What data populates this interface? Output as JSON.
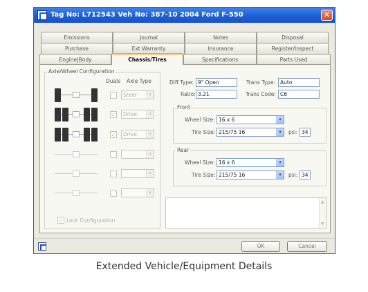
{
  "window": {
    "title": "Tag No: L712543 Veh No: 387-10 2004 Ford F-550",
    "close_glyph": "✕"
  },
  "tabs": {
    "row1": [
      "Emissions",
      "Journal",
      "Notes",
      "Disposal"
    ],
    "row2": [
      "Purchase",
      "Ext Warranty",
      "Insurance",
      "Register/Inspect"
    ],
    "row3": [
      "Engine|Body",
      "Chassis/Tires",
      "Specifications",
      "Parts Used"
    ],
    "active": "Chassis/Tires"
  },
  "axle_config": {
    "legend": "Axle/Wheel Configuration",
    "duals_header": "Duals",
    "axle_type_header": "Axle Type",
    "rows": [
      {
        "duals": false,
        "type": "Steer",
        "tires": 2
      },
      {
        "duals": true,
        "type": "Drive",
        "tires": 4
      },
      {
        "duals": true,
        "type": "Drive",
        "tires": 4
      },
      {
        "duals": false,
        "type": "",
        "tires": 0
      },
      {
        "duals": false,
        "type": "",
        "tires": 0
      },
      {
        "duals": false,
        "type": "",
        "tires": 0
      }
    ],
    "lock_label": "Lock Configuration",
    "lock_checked": true
  },
  "diff": {
    "diff_type_label": "Diff Type:",
    "diff_type": "9\" Open",
    "ratio_label": "Ratio:",
    "ratio": "3.21",
    "trans_type_label": "Trans Type:",
    "trans_type": "Auto",
    "trans_code_label": "Trans Code:",
    "trans_code": "C6"
  },
  "front": {
    "legend": "Front",
    "wheel_size_label": "Wheel Size:",
    "wheel_size": "16 x 6",
    "tire_size_label": "Tire Size:",
    "tire_size": "215/75 16",
    "psi_label": "psi:",
    "psi": "34"
  },
  "rear": {
    "legend": "Rear",
    "wheel_size_label": "Wheel Size:",
    "wheel_size": "16 x 6",
    "tire_size_label": "Tire Size:",
    "tire_size": "215/75 16",
    "psi_label": "psi:",
    "psi": "34"
  },
  "footer": {
    "ok_label": "OK",
    "cancel_label": "Cancel"
  },
  "caption": "Extended Vehicle/Equipment Details"
}
